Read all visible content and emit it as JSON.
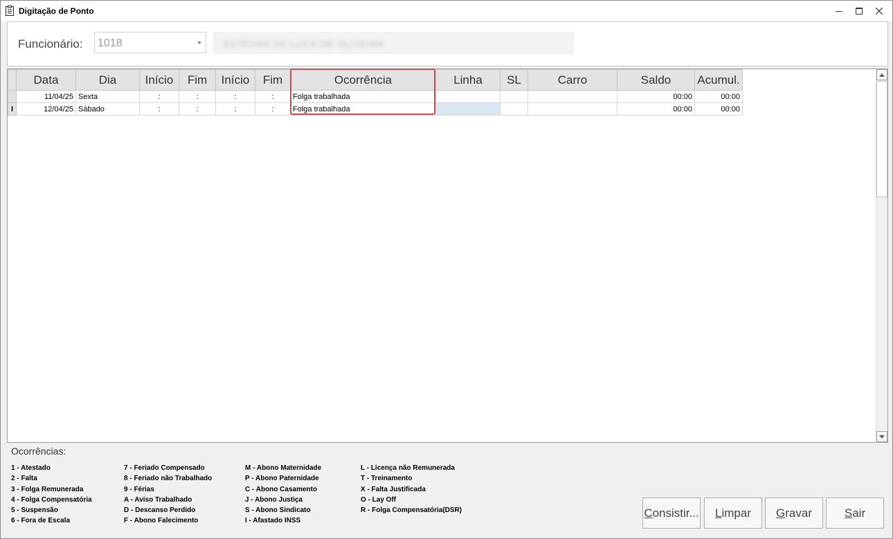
{
  "window": {
    "title": "Digitação de Ponto"
  },
  "header": {
    "employee_label": "Funcionário:",
    "employee_code": "1018",
    "employee_name": "ESTEVAO DE LUCA DE OLIVEIRA"
  },
  "grid": {
    "columns": [
      "Data",
      "Dia",
      "Início",
      "Fim",
      "Início",
      "Fim",
      "Ocorrência",
      "Linha",
      "SL",
      "Carro",
      "Saldo",
      "Acumul."
    ],
    "rows": [
      {
        "indicator": "",
        "data": "11/04/25",
        "dia": "Sexta",
        "inicio1": ":",
        "fim1": ":",
        "inicio2": ":",
        "fim2": ":",
        "ocorrencia": "Folga trabalhada",
        "linha": "",
        "sl": "",
        "carro": "",
        "saldo": "00:00",
        "acumul": "00:00"
      },
      {
        "indicator": "I",
        "data": "12/04/25",
        "dia": "Sábado",
        "inicio1": ":",
        "fim1": ":",
        "inicio2": ":",
        "fim2": ":",
        "ocorrencia": "Folga trabalhada",
        "linha": "",
        "sl": "",
        "carro": "",
        "saldo": "00:00",
        "acumul": "00:00"
      }
    ],
    "highlight_color": "#d94a4a",
    "selected_cell_color": "#d9e7f5"
  },
  "legend": {
    "title": "Ocorrências:",
    "col1": [
      "1 - Atestado",
      "2 - Falta",
      "3 - Folga Remunerada",
      "4 - Folga Compensatória",
      "5 - Suspensão",
      "6 - Fora de Escala"
    ],
    "col2": [
      "7 - Feriado Compensado",
      "8 - Feriado não Trabalhado",
      "9 - Férias",
      "A - Aviso Trabalhado",
      "D - Descanso Perdido",
      "F - Abono Falecimento"
    ],
    "col3": [
      "M - Abono Maternidade",
      "P - Abono Paternidade",
      "C - Abono Casamento",
      "J - Abono Justiça",
      "S - Abono Sindicato",
      "I - Afastado INSS"
    ],
    "col4": [
      "L - Licença não Remunerada",
      "T - Treinamento",
      "X - Falta Justificada",
      "O - Lay Off",
      "R - Folga Compensatória(DSR)"
    ]
  },
  "buttons": {
    "consistir": {
      "first": "C",
      "rest": "onsistir..."
    },
    "limpar": {
      "first": "L",
      "rest": "impar"
    },
    "gravar": {
      "first": "G",
      "rest": "ravar"
    },
    "sair": {
      "first": "S",
      "rest": "air"
    }
  }
}
